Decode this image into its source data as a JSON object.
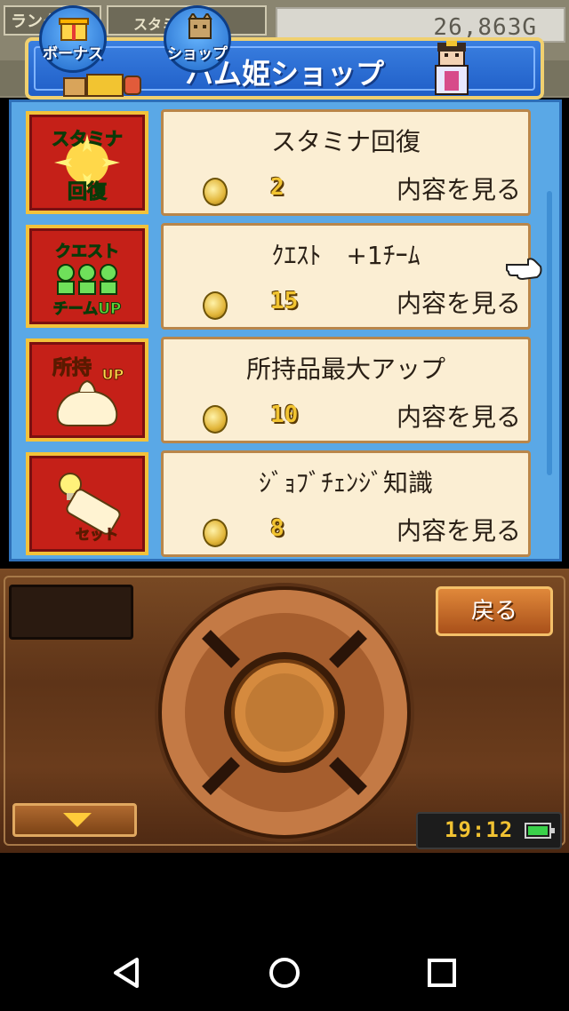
{
  "hud": {
    "rank_label": "ランク",
    "stamina_label": "スタミナ",
    "gold": "26,863G"
  },
  "header": {
    "title": "ハム姫ショップ",
    "bonus_label": "ボーナス",
    "shop_label": "ショップ"
  },
  "items": [
    {
      "name": "スタミナ回復",
      "price": "2",
      "view": "内容を見る",
      "icon": "stamina-recovery-icon"
    },
    {
      "name": "ｸｴｽﾄ　+1ﾁｰﾑ",
      "price": "15",
      "view": "内容を見る",
      "icon": "quest-team-up-icon"
    },
    {
      "name": "所持品最大アップ",
      "price": "10",
      "view": "内容を見る",
      "icon": "inventory-up-icon"
    },
    {
      "name": "ｼﾞｮﾌﾞﾁｪﾝｼﾞ知識",
      "price": "8",
      "view": "内容を見る",
      "icon": "job-change-scroll-icon"
    }
  ],
  "icon_texts": {
    "stamina_top": "スタミナ",
    "stamina_bottom": "回復",
    "quest_top": "クエスト",
    "quest_bottom": "チームUP",
    "possess_top": "所持",
    "possess_up": "UP",
    "set_label": "セット"
  },
  "console": {
    "back_label": "戻る",
    "time": "19:12"
  },
  "colors": {
    "panel_blue": "#5aa8e6",
    "card": "#fbeed3",
    "icon_red": "#c52018",
    "gold_text": "#f2c431"
  }
}
